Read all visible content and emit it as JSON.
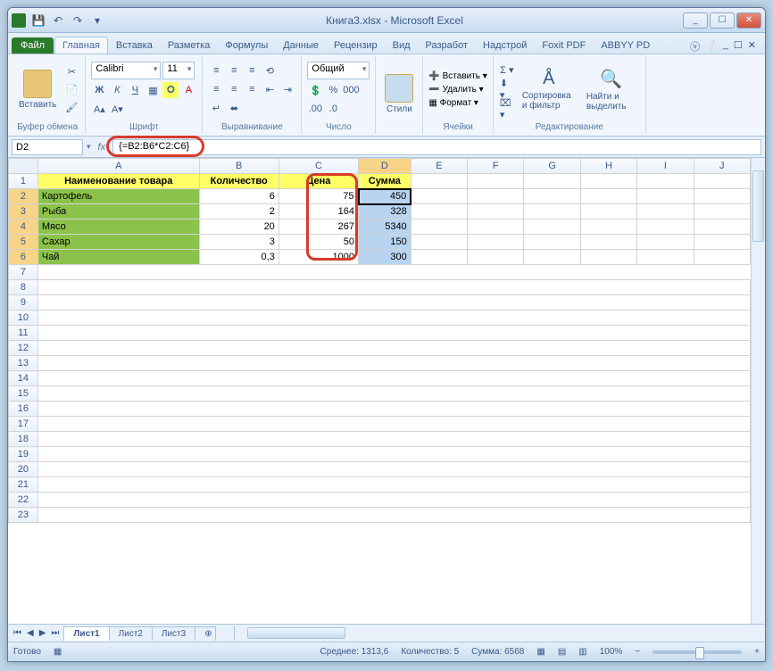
{
  "window": {
    "title": "Книга3.xlsx - Microsoft Excel",
    "min": "_",
    "max": "☐",
    "close": "✕"
  },
  "qat": {
    "save": "💾",
    "undo": "↶",
    "redo": "↷"
  },
  "tabs": {
    "file": "Файл",
    "home": "Главная",
    "insert": "Вставка",
    "layout": "Разметка",
    "formulas": "Формулы",
    "data": "Данные",
    "review": "Рецензир",
    "view": "Вид",
    "developer": "Разработ",
    "addins": "Надстрой",
    "foxit": "Foxit PDF",
    "abbyy": "ABBYY PD"
  },
  "ribbon": {
    "clipboard": {
      "paste": "Вставить",
      "label": "Буфер обмена"
    },
    "font": {
      "name": "Calibri",
      "size": "11",
      "label": "Шрифт"
    },
    "align": {
      "label": "Выравнивание"
    },
    "number": {
      "format": "Общий",
      "label": "Число"
    },
    "styles": {
      "btn": "Стили",
      "label": ""
    },
    "cells": {
      "insert": "Вставить",
      "delete": "Удалить",
      "format": "Формат",
      "label": "Ячейки"
    },
    "editing": {
      "sort": "Сортировка и фильтр",
      "find": "Найти и выделить",
      "label": "Редактирование"
    }
  },
  "fx": {
    "cell_ref": "D2",
    "formula": "{=B2:B6*C2:C6}"
  },
  "columns": [
    "A",
    "B",
    "C",
    "D",
    "E",
    "F",
    "G",
    "H",
    "I",
    "J"
  ],
  "headers": {
    "name": "Наименование товара",
    "qty": "Количество",
    "price": "Цена",
    "sum": "Сумма"
  },
  "rows": [
    {
      "name": "Картофель",
      "qty": "6",
      "price": "75",
      "sum": "450"
    },
    {
      "name": "Рыба",
      "qty": "2",
      "price": "164",
      "sum": "328"
    },
    {
      "name": "Мясо",
      "qty": "20",
      "price": "267",
      "sum": "5340"
    },
    {
      "name": "Сахар",
      "qty": "3",
      "price": "50",
      "sum": "150"
    },
    {
      "name": "Чай",
      "qty": "0,3",
      "price": "1000",
      "sum": "300"
    }
  ],
  "sheets": {
    "s1": "Лист1",
    "s2": "Лист2",
    "s3": "Лист3"
  },
  "status": {
    "ready": "Готово",
    "avg_label": "Среднее:",
    "avg": "1313,6",
    "count_label": "Количество:",
    "count": "5",
    "sum_label": "Сумма:",
    "sum": "6568",
    "zoom": "100%"
  }
}
